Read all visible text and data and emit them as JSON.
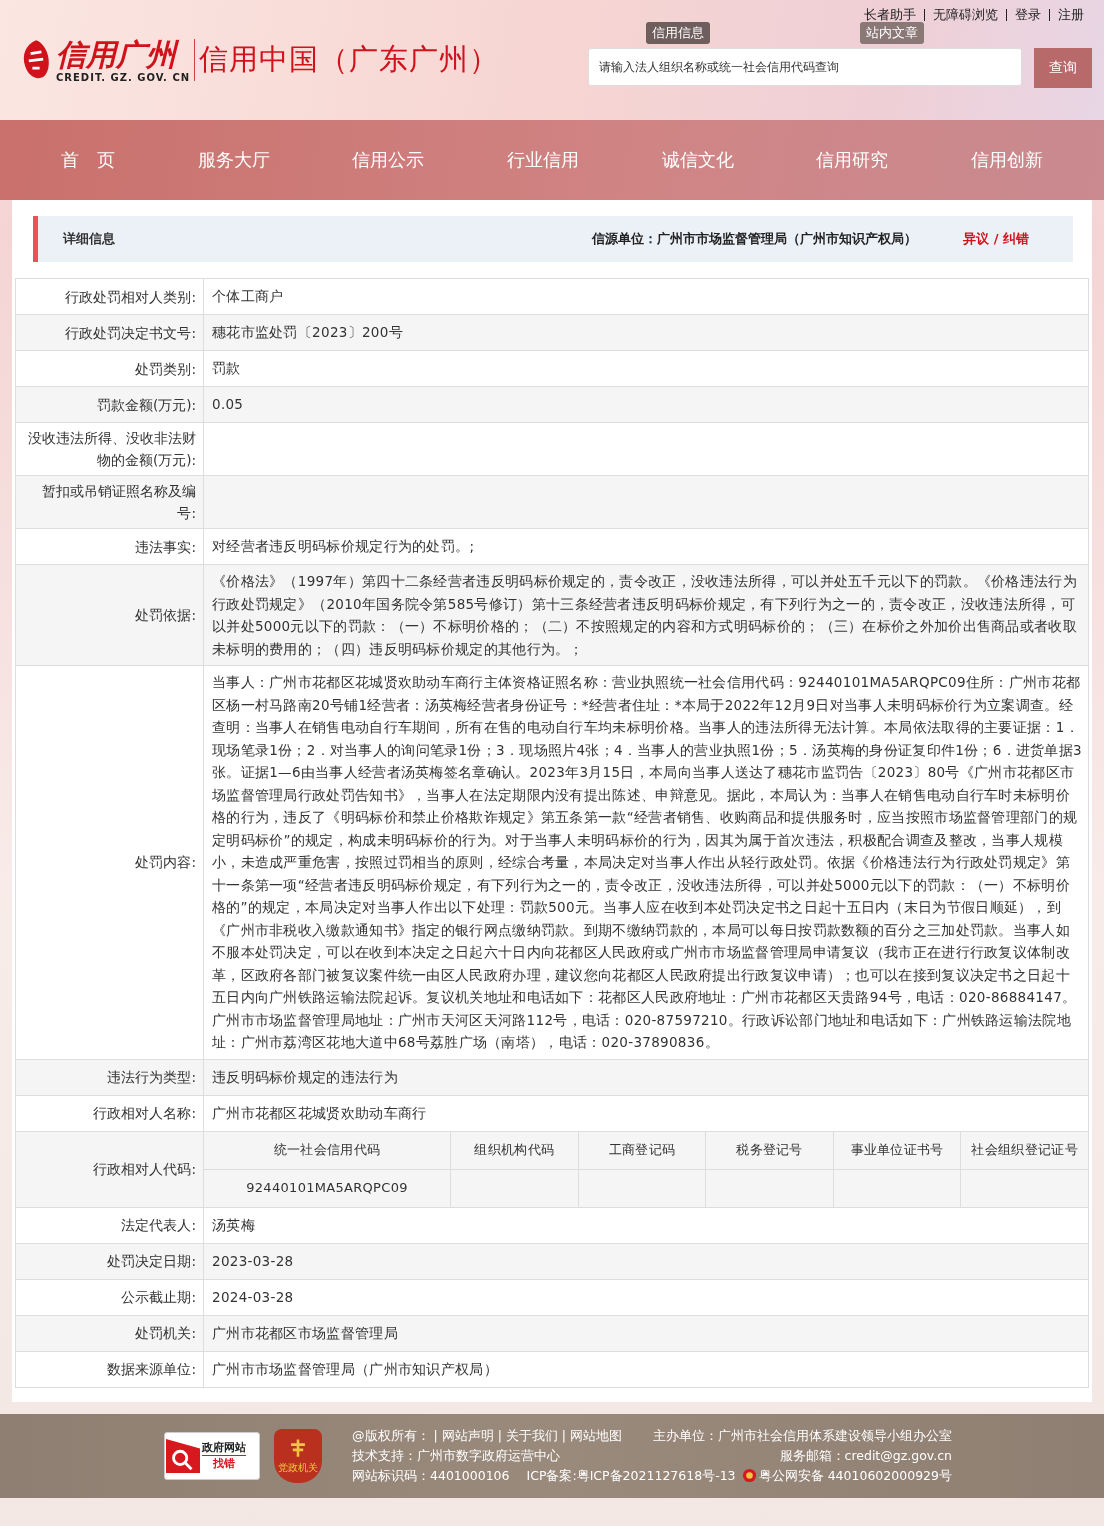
{
  "header": {
    "logo_text": "信用广州",
    "logo_sub": "CREDIT. GZ. GOV. CN",
    "site_title": "信用中国（广东广州）",
    "top_links": [
      "长者助手",
      "无障碍浏览",
      "登录",
      "注册"
    ],
    "search_tabs": [
      {
        "label": "信用信息",
        "selected": true
      },
      {
        "label": "站内文章",
        "selected": false
      }
    ],
    "search": {
      "placeholder": "请输入法人组织名称或统一社会信用代码查询",
      "button": "查询"
    }
  },
  "nav": [
    "首　页",
    "服务大厅",
    "信用公示",
    "行业信用",
    "诚信文化",
    "信用研究",
    "信用创新"
  ],
  "detail": {
    "title": "详细信息",
    "source": "信源单位：广州市市场监督管理局（广州市知识产权局）",
    "dispute_link": "异议 / 纠错"
  },
  "rows": [
    {
      "kind": "text",
      "label": "行政处罚相对人类别:",
      "value": "个体工商户"
    },
    {
      "kind": "text",
      "label": "行政处罚决定书文号:",
      "value": "穗花市监处罚〔2023〕200号"
    },
    {
      "kind": "text",
      "label": "处罚类别:",
      "value": "罚款"
    },
    {
      "kind": "text",
      "label": "罚款金额(万元):",
      "value": "0.05"
    },
    {
      "kind": "text",
      "label": "没收违法所得、没收非法财物的金额(万元):"
    },
    {
      "kind": "text",
      "label": "暂扣或吊销证照名称及编号:"
    },
    {
      "kind": "text",
      "label": "违法事实:",
      "value": "对经营者违反明码标价规定行为的处罚。;"
    },
    {
      "kind": "text",
      "label": "处罚依据:",
      "value": "《价格法》（1997年）第四十二条经营者违反明码标价规定的，责令改正，没收违法所得，可以并处五千元以下的罚款。《价格违法行为行政处罚规定》（2010年国务院令第585号修订）第十三条经营者违反明码标价规定，有下列行为之一的，责令改正，没收违法所得，可以并处5000元以下的罚款：（一）不标明价格的；（二）不按照规定的内容和方式明码标价的；（三）在标价之外加价出售商品或者收取未标明的费用的；（四）违反明码标价规定的其他行为。；"
    },
    {
      "kind": "text",
      "label": "处罚内容:",
      "value": "当事人：广州市花都区花城贤欢助动车商行主体资格证照名称：营业执照统一社会信用代码：92440101MA5ARQPC09住所：广州市花都区杨一村马路南20号铺1经营者：汤英梅经营者身份证号：*经营者住址：*本局于2022年12月9日对当事人未明码标价行为立案调查。经查明：当事人在销售电动自行车期间，所有在售的电动自行车均未标明价格。当事人的违法所得无法计算。本局依法取得的主要证据：1．现场笔录1份；2．对当事人的询问笔录1份；3．现场照片4张；4．当事人的营业执照1份；5．汤英梅的身份证复印件1份；6．进货单据3张。证据1—6由当事人经营者汤英梅签名章确认。2023年3月15日，本局向当事人送达了穗花市监罚告〔2023〕80号《广州市花都区市场监督管理局行政处罚告知书》，当事人在法定期限内没有提出陈述、申辩意见。据此，本局认为：当事人在销售电动自行车时未标明价格的行为，违反了《明码标价和禁止价格欺诈规定》第五条第一款“经营者销售、收购商品和提供服务时，应当按照市场监督管理部门的规定明码标价”的规定，构成未明码标价的行为。对于当事人未明码标价的行为，因其为属于首次违法，积极配合调查及整改，当事人规模小，未造成严重危害，按照过罚相当的原则，经综合考量，本局决定对当事人作出从轻行政处罚。依据《价格违法行为行政处罚规定》第十一条第一项“经营者违反明码标价规定，有下列行为之一的，责令改正，没收违法所得，可以并处5000元以下的罚款：（一）不标明价格的”的规定，本局决定对当事人作出以下处理：罚款500元。当事人应在收到本处罚决定书之日起十五日内（末日为节假日顺延），到《广州市非税收入缴款通知书》指定的银行网点缴纳罚款。到期不缴纳罚款的，本局可以每日按罚款数额的百分之三加处罚款。当事人如不服本处罚决定，可以在收到本决定之日起六十日内向花都区人民政府或广州市市场监督管理局申请复议（我市正在进行行政复议体制改革，区政府各部门被复议案件统一由区人民政府办理，建议您向花都区人民政府提出行政复议申请）；也可以在接到复议决定书之日起十五日内向广州铁路运输法院起诉。复议机关地址和电话如下：花都区人民政府地址：广州市花都区天贵路94号，电话：020-86884147。广州市市场监督管理局地址：广州市天河区天河路112号，电话：020-87597210。行政诉讼部门地址和电话如下：广州铁路运输法院地址：广州市荔湾区花地大道中68号荔胜广场（南塔），电话：020-37890836。"
    },
    {
      "kind": "text",
      "label": "违法行为类型:",
      "value": "违反明码标价规定的违法行为"
    },
    {
      "kind": "text",
      "label": "行政相对人名称:",
      "value": "广州市花都区花城贤欢助动车商行"
    },
    {
      "kind": "codes",
      "label": "行政相对人代码:",
      "columns": [
        "统一社会信用代码",
        "组织机构代码",
        "工商登记码",
        "税务登记号",
        "事业单位证书号",
        "社会组织登记证号"
      ],
      "values": [
        "92440101MA5ARQPC09"
      ]
    },
    {
      "kind": "text",
      "label": "法定代表人:",
      "value": "汤英梅"
    },
    {
      "kind": "text",
      "label": "处罚决定日期:",
      "value": "2023-03-28"
    },
    {
      "kind": "text",
      "label": "公示截止期:",
      "value": "2024-03-28"
    },
    {
      "kind": "text",
      "label": "处罚机关:",
      "value": "广州市花都区市场监督管理局"
    },
    {
      "kind": "text",
      "label": "数据来源单位:",
      "value": "广州市市场监督管理局（广州市知识产权局）"
    }
  ],
  "footer": {
    "badge_top": "政府网站",
    "badge_bottom": "找错",
    "emblem_text": "党政机关",
    "lines": [
      [
        "@版权所有： | 网站声明 | 关于我们 | 网站地图",
        "主办单位：广州市社会信用体系建设领导小组办公室"
      ],
      [
        "技术支持：广州市数字政府运营中心",
        "服务邮箱：credit@gz.gov.cn"
      ],
      [
        "网站标识码：4401000106　 ICP备案:粤ICP备2021127618号-13",
        "粤公网安备 44010602000929号"
      ]
    ]
  }
}
